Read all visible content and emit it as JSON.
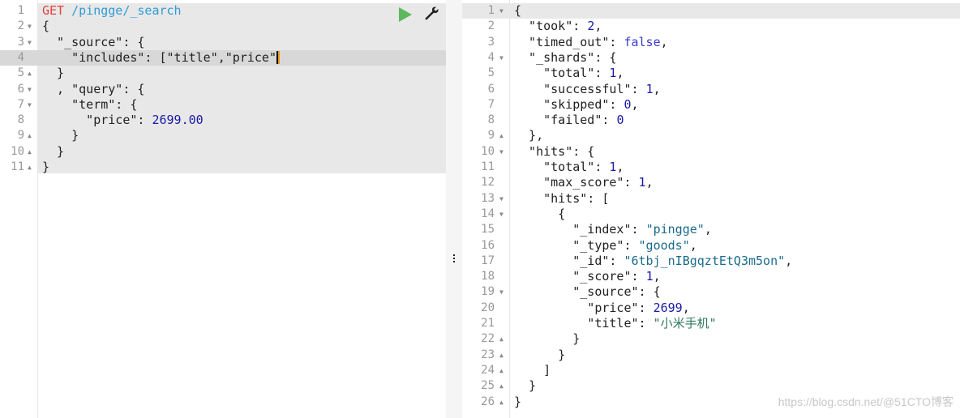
{
  "request": {
    "method": "GET",
    "path": "/pingge/_search",
    "lines": [
      {
        "n": "1",
        "fold": "",
        "segs": []
      },
      {
        "n": "2",
        "fold": "▼",
        "text": "{"
      },
      {
        "n": "3",
        "fold": "▼",
        "text": "  \"_source\": {"
      },
      {
        "n": "4",
        "fold": "",
        "text": "    \"includes\": [\"title\",\"price\"",
        "active": true
      },
      {
        "n": "5",
        "fold": "▲",
        "text": "  }"
      },
      {
        "n": "6",
        "fold": "▼",
        "text": "  , \"query\": {"
      },
      {
        "n": "7",
        "fold": "▼",
        "text": "    \"term\": {"
      },
      {
        "n": "8",
        "fold": "",
        "key": "      \"price\": ",
        "num": "2699.00"
      },
      {
        "n": "9",
        "fold": "▲",
        "text": "    }"
      },
      {
        "n": "10",
        "fold": "▲",
        "text": "  }"
      },
      {
        "n": "11",
        "fold": "▲",
        "text": "}"
      }
    ],
    "run_button": "play-icon",
    "settings_button": "wrench-icon"
  },
  "response": {
    "lines": [
      {
        "n": "1",
        "fold": "▼",
        "text": "{"
      },
      {
        "n": "2",
        "fold": "",
        "key": "  \"took\": ",
        "num": "2",
        "tail": ","
      },
      {
        "n": "3",
        "fold": "",
        "key": "  \"timed_out\": ",
        "bool": "false",
        "tail": ","
      },
      {
        "n": "4",
        "fold": "▼",
        "text": "  \"_shards\": {"
      },
      {
        "n": "5",
        "fold": "",
        "key": "    \"total\": ",
        "num": "1",
        "tail": ","
      },
      {
        "n": "6",
        "fold": "",
        "key": "    \"successful\": ",
        "num": "1",
        "tail": ","
      },
      {
        "n": "7",
        "fold": "",
        "key": "    \"skipped\": ",
        "num": "0",
        "tail": ","
      },
      {
        "n": "8",
        "fold": "",
        "key": "    \"failed\": ",
        "num": "0",
        "tail": ""
      },
      {
        "n": "9",
        "fold": "▲",
        "text": "  },"
      },
      {
        "n": "10",
        "fold": "▼",
        "text": "  \"hits\": {"
      },
      {
        "n": "11",
        "fold": "",
        "key": "    \"total\": ",
        "num": "1",
        "tail": ","
      },
      {
        "n": "12",
        "fold": "",
        "key": "    \"max_score\": ",
        "num": "1",
        "tail": ","
      },
      {
        "n": "13",
        "fold": "▼",
        "text": "    \"hits\": ["
      },
      {
        "n": "14",
        "fold": "▼",
        "text": "      {"
      },
      {
        "n": "15",
        "fold": "",
        "key": "        \"_index\": ",
        "str": "\"pingge\"",
        "tail": ","
      },
      {
        "n": "16",
        "fold": "",
        "key": "        \"_type\": ",
        "str": "\"goods\"",
        "tail": ","
      },
      {
        "n": "17",
        "fold": "",
        "key": "        \"_id\": ",
        "str": "\"6tbj_nIBgqztEtQ3m5on\"",
        "tail": ","
      },
      {
        "n": "18",
        "fold": "",
        "key": "        \"_score\": ",
        "num": "1",
        "tail": ","
      },
      {
        "n": "19",
        "fold": "▼",
        "text": "        \"_source\": {"
      },
      {
        "n": "20",
        "fold": "",
        "key": "          \"price\": ",
        "num": "2699",
        "tail": ","
      },
      {
        "n": "21",
        "fold": "",
        "key": "          \"title\": ",
        "str": "\"小米手机\"",
        "tail": ""
      },
      {
        "n": "22",
        "fold": "▲",
        "text": "        }"
      },
      {
        "n": "23",
        "fold": "▲",
        "text": "      }"
      },
      {
        "n": "24",
        "fold": "▲",
        "text": "    ]"
      },
      {
        "n": "25",
        "fold": "▲",
        "text": "  }"
      },
      {
        "n": "26",
        "fold": "▲",
        "text": "}"
      }
    ]
  },
  "watermark": "https://blog.csdn.net/@51CTO博客"
}
